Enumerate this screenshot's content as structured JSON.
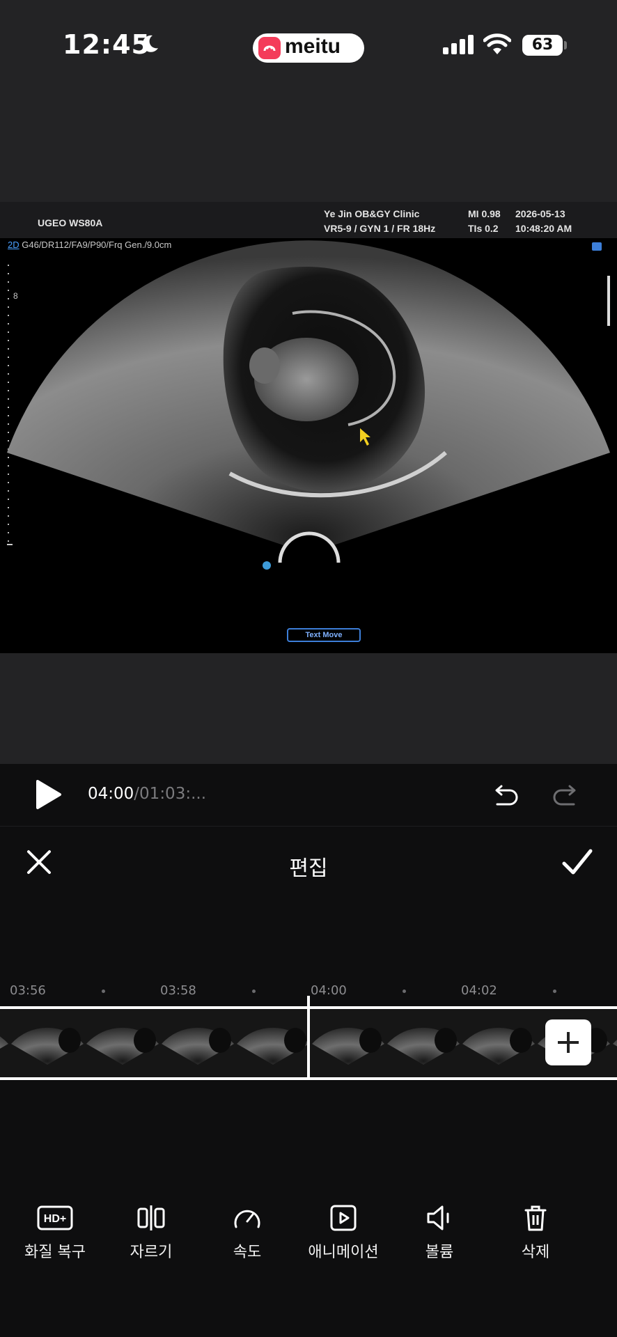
{
  "status_bar": {
    "time": "12:45",
    "app_brand": "meitu",
    "battery": "63"
  },
  "ultrasound": {
    "device": "UGEO WS80A",
    "clinic": "Ye Jin OB&GY Clinic",
    "probe_settings": "VR5-9 / GYN 1 / FR 18Hz",
    "mi": "MI  0.98",
    "tis": "TIs 0.2",
    "date": "2026-05-13",
    "time": "10:48:20 AM",
    "mode": "2D",
    "params": "G46/DR112/FA9/P90/Frq Gen./9.0cm",
    "depth_mark": "8",
    "text_move": "Text Move"
  },
  "player": {
    "current_time": "04:00",
    "total_time": "/01:03:..."
  },
  "editor": {
    "title": "편집"
  },
  "timeline": {
    "ticks": [
      "03:56",
      "03:58",
      "04:00",
      "04:02"
    ]
  },
  "toolbar": {
    "items": [
      {
        "label": "화질 복구",
        "icon": "hd-plus-icon"
      },
      {
        "label": "자르기",
        "icon": "split-icon"
      },
      {
        "label": "속도",
        "icon": "speed-gauge-icon"
      },
      {
        "label": "애니메이션",
        "icon": "animation-play-icon"
      },
      {
        "label": "볼륨",
        "icon": "volume-icon"
      },
      {
        "label": "삭제",
        "icon": "trash-icon"
      }
    ]
  },
  "colors": {
    "background": "#0e0e0f",
    "preview_background": "#232325",
    "brand": "#f43c5a"
  }
}
